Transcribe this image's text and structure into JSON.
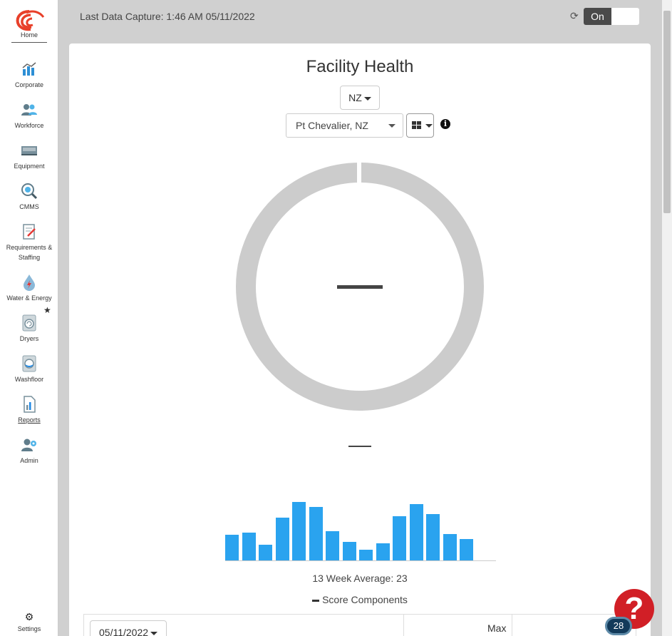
{
  "sidebar": {
    "logo_label": "Home",
    "items": [
      {
        "label": "Corporate",
        "icon": "corporate-icon"
      },
      {
        "label": "Workforce",
        "icon": "workforce-icon"
      },
      {
        "label": "Equipment",
        "icon": "equipment-icon"
      },
      {
        "label": "CMMS",
        "icon": "cmms-icon"
      },
      {
        "label": "Requirements & Staffing",
        "icon": "requirements-icon"
      },
      {
        "label": "Water & Energy",
        "icon": "water-energy-icon"
      },
      {
        "label": "Dryers",
        "icon": "dryers-icon"
      },
      {
        "label": "Washfloor",
        "icon": "washfloor-icon"
      },
      {
        "label": "Reports",
        "icon": "reports-icon"
      },
      {
        "label": "Admin",
        "icon": "admin-icon"
      }
    ],
    "settings_label": "Settings"
  },
  "topbar": {
    "capture_text": "Last Data Capture: 1:46 AM 05/11/2022",
    "toggle_on_label": "On"
  },
  "card": {
    "title": "Facility Health",
    "region": "NZ",
    "facility": "Pt Chevalier, NZ",
    "average_text": "13 Week Average: 23",
    "components_label": "Score Components",
    "date": "05/11/2022",
    "max_header": "Max"
  },
  "chart_data": {
    "type": "bar",
    "values": [
      19,
      21,
      12,
      32,
      44,
      40,
      22,
      14,
      8,
      13,
      33,
      42,
      35,
      20,
      16
    ],
    "ylim": [
      0,
      46
    ]
  },
  "help": {
    "icon": "?",
    "badge": "28"
  },
  "colors": {
    "bar": "#2aa3ef",
    "help": "#d11f26",
    "donut": "#cccccc"
  }
}
